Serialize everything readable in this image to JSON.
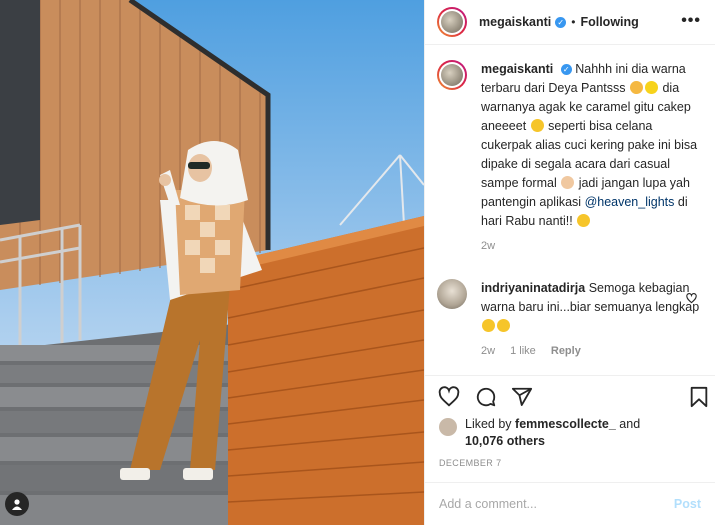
{
  "post": {
    "username": "megaiskanti",
    "follow_separator": "•",
    "follow_label": "Following",
    "more_label": "•••"
  },
  "caption": {
    "username": "megaiskanti",
    "line1": "Nahhh ini dia warna terbaru dari Deya Pantsss",
    "line2": "dia warnanya agak ke caramel gitu cakep aneeeet",
    "line3": "seperti bisa celana cukerpak alias cuci kering pake ini bisa dipake di segala acara dari casual sampe formal",
    "line4": "jadi jangan lupa yah pantengin aplikasi",
    "mention": "@heaven_lights",
    "line5": "di hari Rabu nanti!!",
    "time": "2w"
  },
  "comment": {
    "username": "indriyaninatadirja",
    "text": "Semoga kebagian warna baru ini...biar semuanya lengkap",
    "time": "2w",
    "likes": "1 like",
    "reply": "Reply"
  },
  "likes": {
    "prefix": "Liked by",
    "user": "femmescollecte_",
    "and": "and",
    "count": "10,076 others"
  },
  "date": "DECEMBER 7",
  "add_comment": {
    "placeholder": "Add a comment...",
    "post_label": "Post"
  },
  "icons": [
    "heart-icon",
    "comment-icon",
    "share-icon",
    "bookmark-icon",
    "verified-icon",
    "user-tag-icon",
    "small-heart-icon"
  ],
  "colors": {
    "verified": "#3897f0",
    "post_button": "#b2dffc",
    "mention": "#003569",
    "meta": "#8e8e8e"
  }
}
